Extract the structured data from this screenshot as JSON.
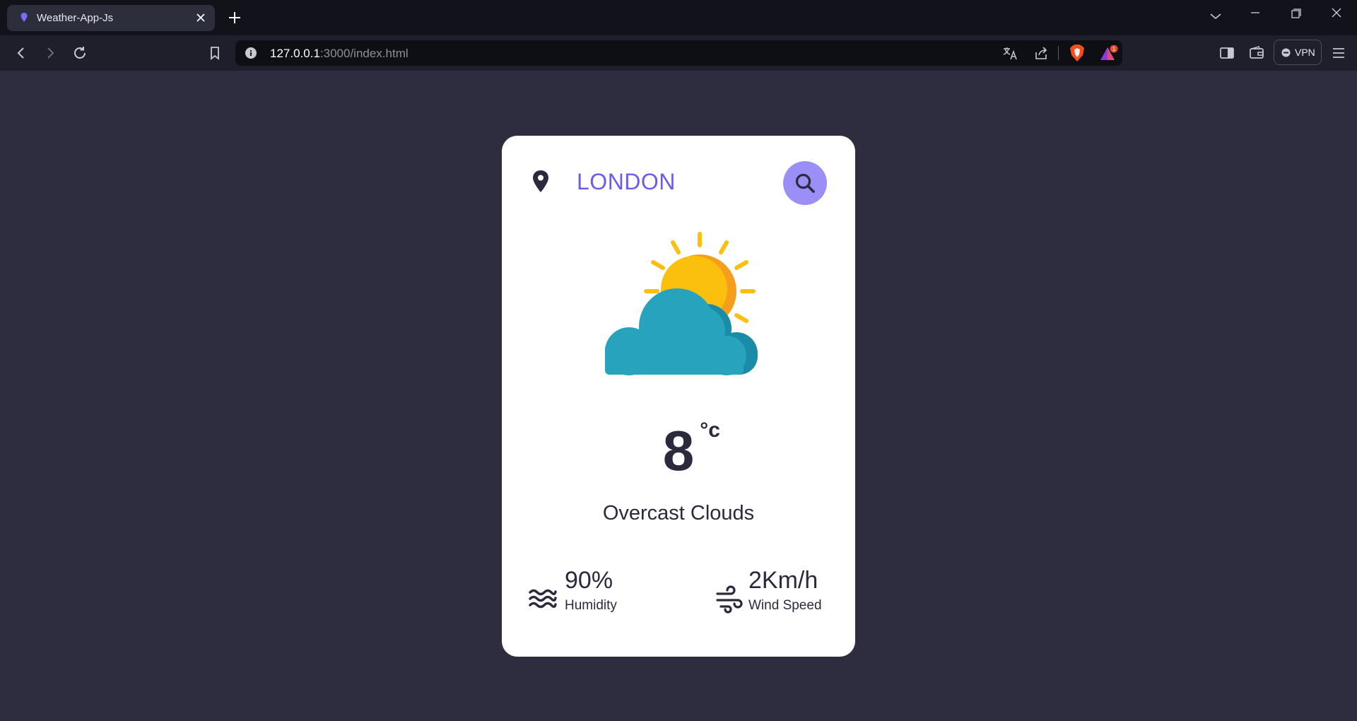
{
  "browser": {
    "tab_title": "Weather-App-Js",
    "url_host": "127.0.0.1",
    "url_path": ":3000/index.html",
    "vpn_label": "VPN",
    "notification_count": "1"
  },
  "weather": {
    "city": "LONDON",
    "temperature": "8",
    "unit": "°c",
    "description": "Overcast Clouds",
    "humidity_value": "90%",
    "humidity_label": "Humidity",
    "wind_value": "2Km/h",
    "wind_label": "Wind Speed",
    "icon": "sun-behind-cloud-icon"
  },
  "colors": {
    "page_bg": "#2e2d40",
    "accent": "#6b5cf0",
    "search_button": "#9b8ef6",
    "text": "#2b2a3d",
    "sun": "#fbbf0e",
    "cloud": "#27a3bd"
  }
}
